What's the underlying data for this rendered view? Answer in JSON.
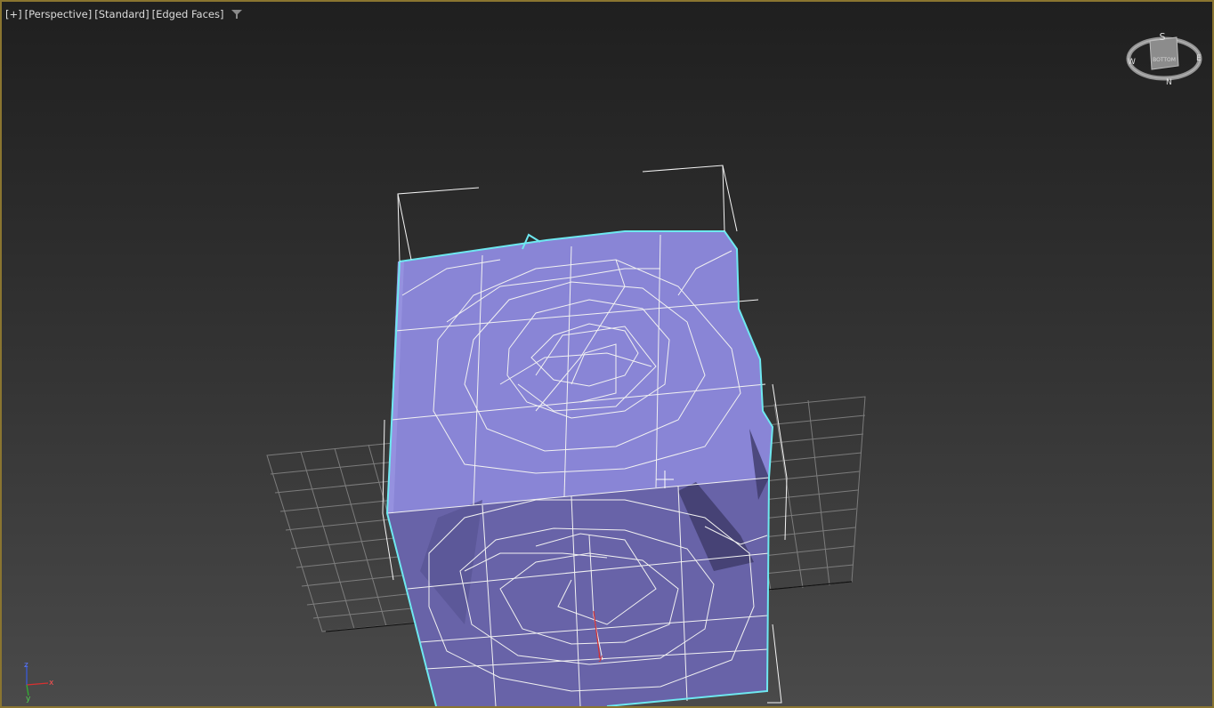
{
  "viewport": {
    "labels": [
      "+",
      "Perspective",
      "Standard",
      "Edged Faces"
    ],
    "filter_icon": "filter-icon"
  },
  "viewcube": {
    "top_letter": "S",
    "west_letter": "W",
    "east_letter": "E",
    "north_letter": "N",
    "face_label": "BOTTOM"
  },
  "axis_tripod": {
    "z": "z",
    "x": "x",
    "y": "y"
  },
  "colors": {
    "viewport_border": "#8a7530",
    "object_fill": "#8a86d8",
    "selection_edge": "#6ee8f0",
    "wire": "#f2f2f2",
    "grid": "#8f8f8f"
  }
}
